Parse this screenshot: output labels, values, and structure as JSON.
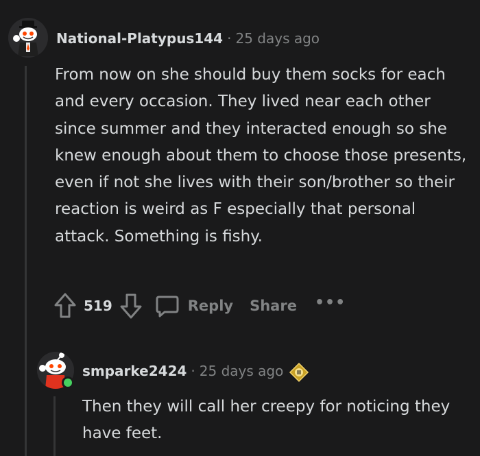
{
  "comment": {
    "username": "National-Platypus144",
    "separator": "·",
    "timestamp": "25 days ago",
    "body": "From now on she should buy them socks for each and every occasion. They lived near each other since summer and they interacted enough so she knew enough about them to choose those presents, even if not she lives with their son/brother so their reaction is weird as F especially that personal attack. Something is fishy.",
    "vote_count": "519",
    "actions": {
      "reply_label": "Reply",
      "share_label": "Share",
      "more_label": "•••"
    },
    "icons": {
      "upvote": "upvote-arrow-icon",
      "downvote": "downvote-arrow-icon",
      "reply": "speech-bubble-icon",
      "more": "more-options-icon"
    }
  },
  "reply": {
    "username": "smparke2424",
    "separator": "·",
    "timestamp": "25 days ago",
    "body": "Then they will call her creepy for noticing they have feet.",
    "flair_icon": "award-flair-icon",
    "online": true
  },
  "colors": {
    "background": "#1a1a1b",
    "text": "#d7dadc",
    "muted": "#818384",
    "thread_line": "#343536",
    "online": "#46d160"
  }
}
